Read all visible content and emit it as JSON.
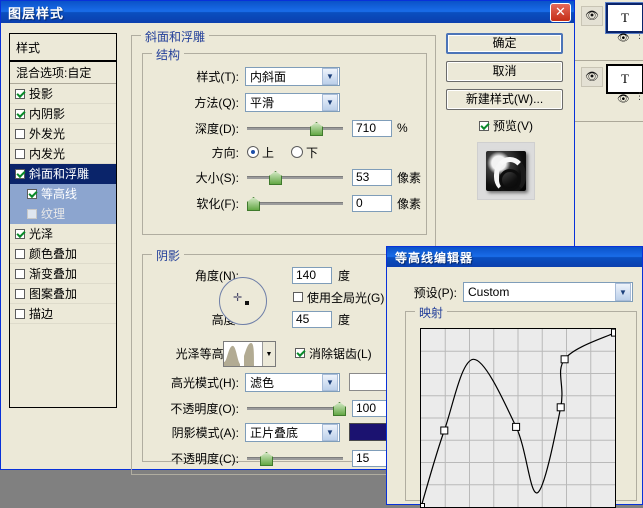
{
  "layers_panel": {
    "layers": [
      {
        "thumb_letter": "T",
        "selected": true,
        "eye_icon": "eye-icon",
        "sub_eye_icon": "eye-icon"
      },
      {
        "thumb_letter": "T",
        "selected": false,
        "eye_icon": "eye-icon",
        "sub_eye_icon": "eye-icon"
      }
    ]
  },
  "layer_style_dialog": {
    "title": "图层样式",
    "close_label": "✕",
    "sidebar": {
      "header": "样式",
      "blend_options": "混合选项:自定",
      "items": [
        {
          "label": "投影",
          "checked": true,
          "level": 0,
          "selected": false
        },
        {
          "label": "内阴影",
          "checked": true,
          "level": 0,
          "selected": false
        },
        {
          "label": "外发光",
          "checked": false,
          "level": 0,
          "selected": false
        },
        {
          "label": "内发光",
          "checked": false,
          "level": 0,
          "selected": false
        },
        {
          "label": "斜面和浮雕",
          "checked": true,
          "level": 0,
          "selected": true
        },
        {
          "label": "等高线",
          "checked": true,
          "level": 1,
          "selected": true
        },
        {
          "label": "纹理",
          "checked": false,
          "level": 1,
          "selected": true
        },
        {
          "label": "光泽",
          "checked": true,
          "level": 0,
          "selected": false
        },
        {
          "label": "颜色叠加",
          "checked": false,
          "level": 0,
          "selected": false
        },
        {
          "label": "渐变叠加",
          "checked": false,
          "level": 0,
          "selected": false
        },
        {
          "label": "图案叠加",
          "checked": false,
          "level": 0,
          "selected": false
        },
        {
          "label": "描边",
          "checked": false,
          "level": 0,
          "selected": false
        }
      ]
    },
    "buttons": {
      "ok": "确定",
      "cancel": "取消",
      "new_style": "新建样式(W)...",
      "preview_label": "预览(V)",
      "preview_checked": true
    },
    "bevel_group_title": "斜面和浮雕",
    "structure": {
      "title": "结构",
      "style_label": "样式(T):",
      "style_value": "内斜面",
      "technique_label": "方法(Q):",
      "technique_value": "平滑",
      "depth_label": "深度(D):",
      "depth_value": "710",
      "depth_unit": "%",
      "direction_label": "方向:",
      "direction_up": "上",
      "direction_down": "下",
      "direction_selected": "上",
      "size_label": "大小(S):",
      "size_value": "53",
      "size_unit": "像素",
      "soften_label": "软化(F):",
      "soften_value": "0",
      "soften_unit": "像素"
    },
    "shading": {
      "title": "阴影",
      "angle_label": "角度(N):",
      "angle_value": "140",
      "angle_unit": "度",
      "global_light_label": "使用全局光(G)",
      "global_light_checked": false,
      "altitude_label": "高度:",
      "altitude_value": "45",
      "altitude_unit": "度",
      "gloss_contour_label": "光泽等高线:",
      "antialias_label": "消除锯齿(L)",
      "antialias_checked": true,
      "highlight_mode_label": "高光模式(H):",
      "highlight_mode_value": "滤色",
      "highlight_color": "#ffffff",
      "highlight_opacity_label": "不透明度(O):",
      "highlight_opacity_value": "100",
      "highlight_opacity_unit": "%",
      "shadow_mode_label": "阴影模式(A):",
      "shadow_mode_value": "正片叠底",
      "shadow_color": "#1b1270",
      "shadow_opacity_label": "不透明度(C):",
      "shadow_opacity_value": "15",
      "shadow_opacity_unit": "%"
    }
  },
  "contour_editor_dialog": {
    "title": "等高线编辑器",
    "preset_label": "预设(P):",
    "preset_value": "Custom",
    "map_group_title": "映射"
  },
  "chart_data": {
    "type": "line",
    "title": "映射",
    "xlabel": "",
    "ylabel": "",
    "xlim": [
      0,
      100
    ],
    "ylim": [
      0,
      100
    ],
    "grid": true,
    "grid_divisions": 8,
    "points": [
      {
        "x": 0,
        "y": 0,
        "handle": true
      },
      {
        "x": 12,
        "y": 43,
        "handle": true
      },
      {
        "x": 27,
        "y": 83,
        "handle": false
      },
      {
        "x": 49,
        "y": 45,
        "handle": true
      },
      {
        "x": 60,
        "y": 8,
        "handle": false
      },
      {
        "x": 72,
        "y": 56,
        "handle": true
      },
      {
        "x": 74,
        "y": 83,
        "handle": true
      },
      {
        "x": 100,
        "y": 98,
        "handle": true
      }
    ]
  },
  "colors": {
    "titlebar_blue": "#0a52c8",
    "dialog_face": "#ece9d8",
    "selection_blue": "#0a246a",
    "sub_selection_blue": "#8ca5cf",
    "group_title_blue": "#24409a",
    "shadow_color": "#1b1270",
    "desktop_gray": "#808080"
  }
}
